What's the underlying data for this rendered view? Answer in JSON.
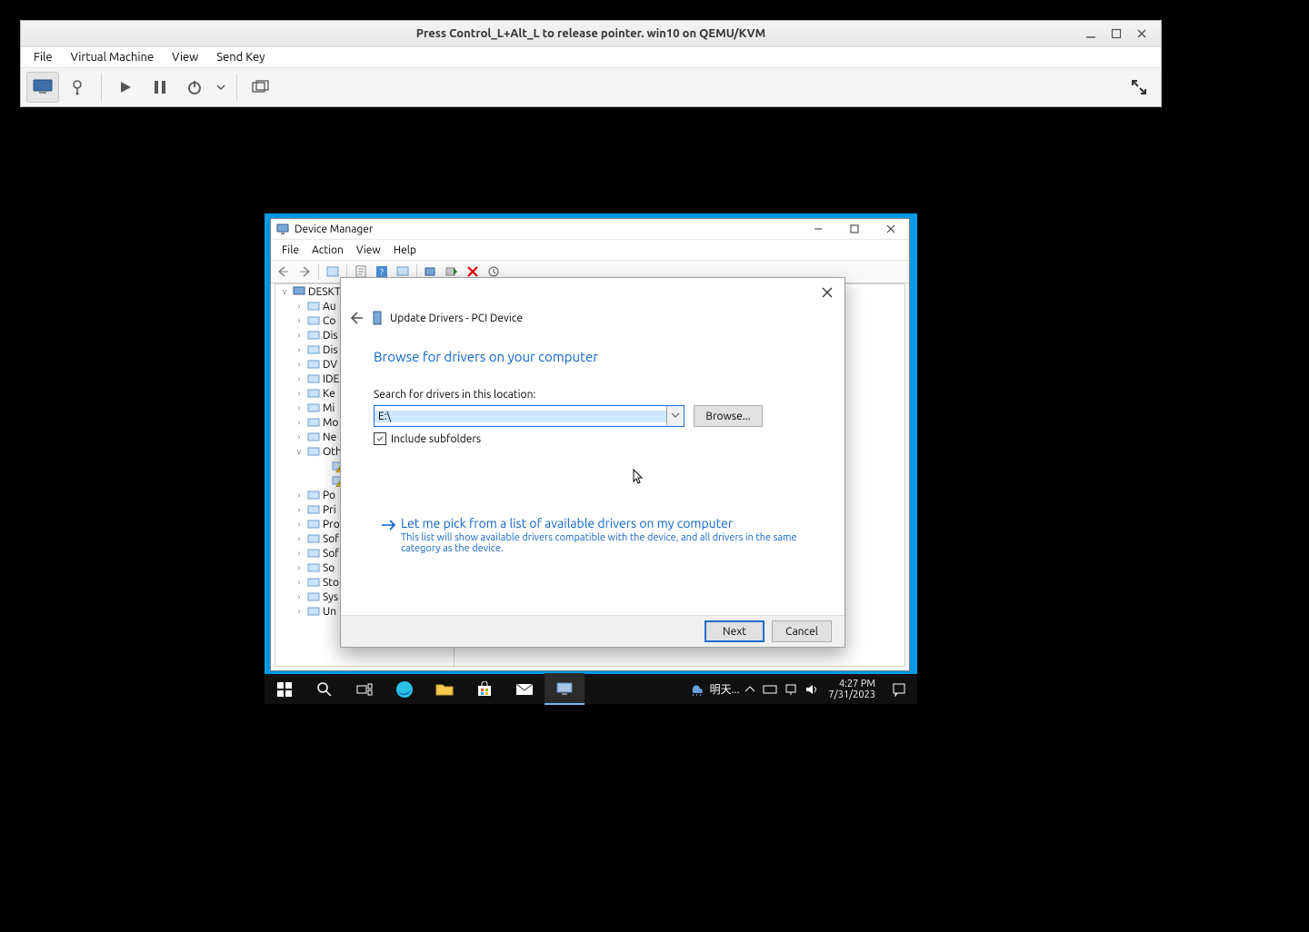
{
  "vm": {
    "title": "Press Control_L+Alt_L to release pointer. win10 on QEMU/KVM",
    "menu": {
      "file": "File",
      "virtual_machine": "Virtual Machine",
      "view": "View",
      "send_key": "Send Key"
    }
  },
  "devmgr": {
    "title": "Device Manager",
    "menu": {
      "file": "File",
      "action": "Action",
      "view": "View",
      "help": "Help"
    },
    "tree": {
      "root": "DESKTO",
      "items": [
        {
          "label": "Au",
          "expand": ">"
        },
        {
          "label": "Co",
          "expand": ">"
        },
        {
          "label": "Dis",
          "expand": ">"
        },
        {
          "label": "Dis",
          "expand": ">"
        },
        {
          "label": "DV",
          "expand": ">"
        },
        {
          "label": "IDE",
          "expand": ">"
        },
        {
          "label": "Ke",
          "expand": ">"
        },
        {
          "label": "Mi",
          "expand": ">"
        },
        {
          "label": "Mo",
          "expand": ">"
        },
        {
          "label": "Ne",
          "expand": ">"
        },
        {
          "label": "Oth",
          "expand": "v"
        },
        {
          "label": "",
          "expand": "",
          "warn": true,
          "indent": true
        },
        {
          "label": "",
          "expand": "",
          "warn": true,
          "indent": true
        },
        {
          "label": "Po",
          "expand": ">"
        },
        {
          "label": "Pri",
          "expand": ">"
        },
        {
          "label": "Pro",
          "expand": ">"
        },
        {
          "label": "Sof",
          "expand": ">"
        },
        {
          "label": "Sof",
          "expand": ">"
        },
        {
          "label": "So",
          "expand": ">"
        },
        {
          "label": "Sto",
          "expand": ">"
        },
        {
          "label": "Sys",
          "expand": ">"
        },
        {
          "label": "Un",
          "expand": ">"
        }
      ]
    }
  },
  "upd": {
    "title": "Update Drivers - PCI Device",
    "heading": "Browse for drivers on your computer",
    "search_label": "Search for drivers in this location:",
    "path_value": "E:\\",
    "browse": "Browse...",
    "include_sub": "Include subfolders",
    "letme_title": "Let me pick from a list of available drivers on my computer",
    "letme_desc": "This list will show available drivers compatible with the device, and all drivers in the same category as the device.",
    "next": "Next",
    "cancel": "Cancel"
  },
  "taskbar": {
    "weather_text": "明天...",
    "time": "4:27 PM",
    "date": "7/31/2023"
  }
}
